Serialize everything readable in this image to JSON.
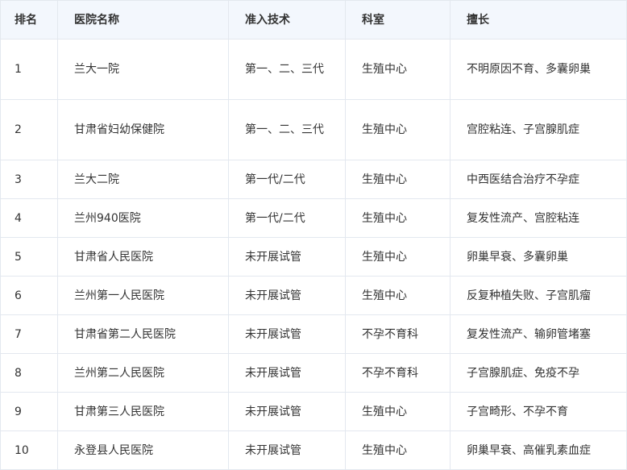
{
  "table": {
    "headers": [
      "排名",
      "医院名称",
      "准入技术",
      "科室",
      "擅长"
    ],
    "rows": [
      [
        "1",
        "兰大一院",
        "第一、二、三代",
        "生殖中心",
        "不明原因不育、多囊卵巢"
      ],
      [
        "2",
        "甘肃省妇幼保健院",
        "第一、二、三代",
        "生殖中心",
        "宫腔粘连、子宫腺肌症"
      ],
      [
        "3",
        "兰大二院",
        "第一代/二代",
        "生殖中心",
        "中西医结合治疗不孕症"
      ],
      [
        "4",
        "兰州940医院",
        "第一代/二代",
        "生殖中心",
        "复发性流产、宫腔粘连"
      ],
      [
        "5",
        "甘肃省人民医院",
        "未开展试管",
        "生殖中心",
        "卵巢早衰、多囊卵巢"
      ],
      [
        "6",
        "兰州第一人民医院",
        "未开展试管",
        "生殖中心",
        "反复种植失败、子宫肌瘤"
      ],
      [
        "7",
        "甘肃省第二人民医院",
        "未开展试管",
        "不孕不育科",
        "复发性流产、输卵管堵塞"
      ],
      [
        "8",
        "兰州第二人民医院",
        "未开展试管",
        "不孕不育科",
        "子宫腺肌症、免疫不孕"
      ],
      [
        "9",
        "甘肃第三人民医院",
        "未开展试管",
        "生殖中心",
        "子宫畸形、不孕不育"
      ],
      [
        "10",
        "永登县人民医院",
        "未开展试管",
        "生殖中心",
        "卵巢早衰、高催乳素血症"
      ]
    ]
  }
}
